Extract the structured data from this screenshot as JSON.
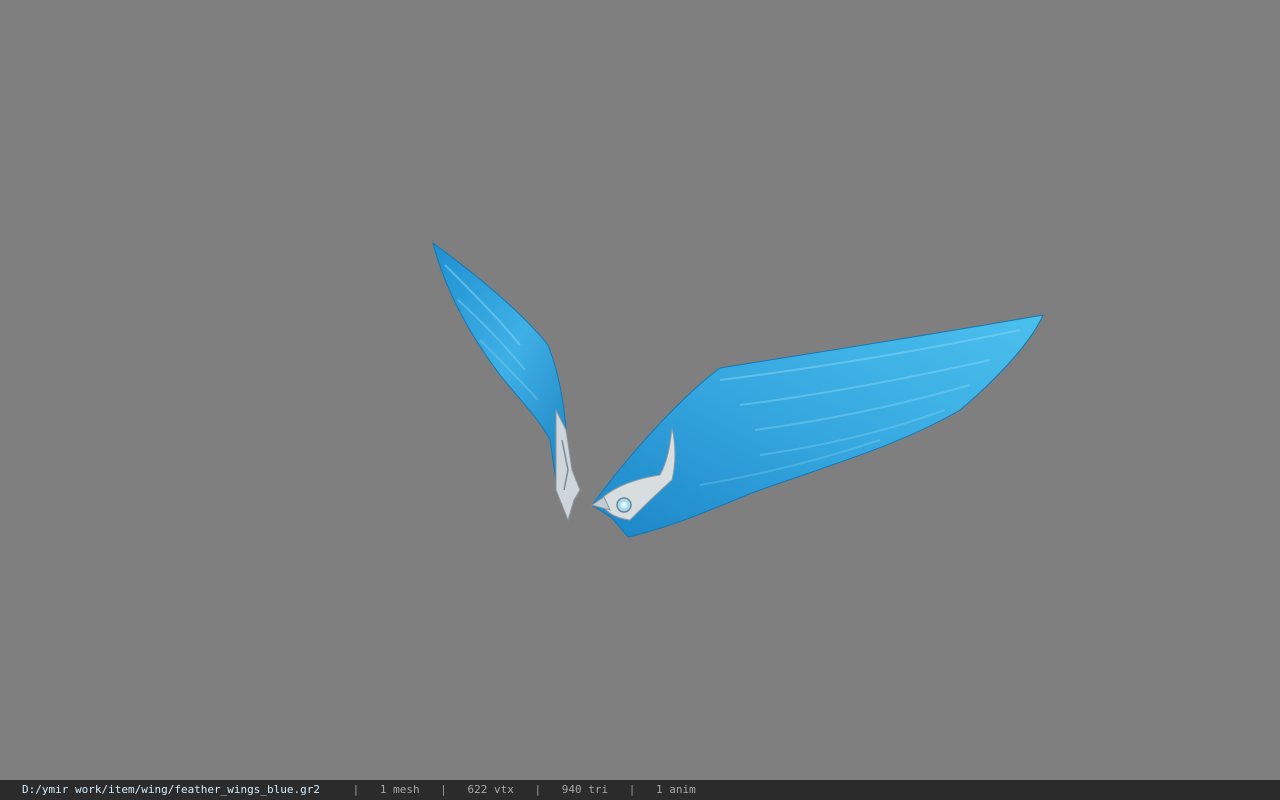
{
  "viewport": {
    "model_name": "feather_wings_blue",
    "background_color": "#7f7f7f",
    "wing_color": "#2a9fd6",
    "trim_color": "#d8dde0"
  },
  "statusbar": {
    "file_path": "D:/ymir work/item/wing/feather_wings_blue.gr2",
    "separator": "|",
    "meshes": "1 mesh",
    "vertices": "622 vtx",
    "triangles": "940 tri",
    "animations": "1 anim"
  }
}
